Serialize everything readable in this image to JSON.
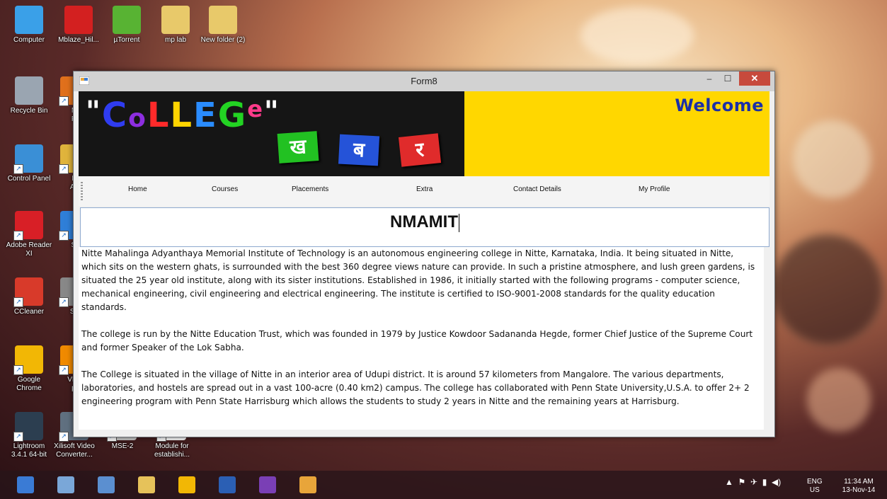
{
  "desktop": {
    "icons": [
      {
        "label": "Computer",
        "icon": "computer-icon",
        "color": "#3aa0e8"
      },
      {
        "label": "Mblaze_Hil...",
        "icon": "mblaze-icon",
        "color": "#d32020"
      },
      {
        "label": "µTorrent",
        "icon": "utorrent-icon",
        "color": "#58b333"
      },
      {
        "label": "mp lab",
        "icon": "folder-icon",
        "color": "#e8c96a"
      },
      {
        "label": "New folder (2)",
        "icon": "folder-icon",
        "color": "#e8c96a"
      },
      {
        "label": "Recycle Bin",
        "icon": "recycle-bin-icon",
        "color": "#9aa5b1"
      },
      {
        "label": "M\nFi",
        "icon": "firefox-icon",
        "color": "#e0701c"
      },
      {
        "label": "Control Panel",
        "icon": "control-panel-icon",
        "color": "#3a8fd6"
      },
      {
        "label": "N\nAn",
        "icon": "app-icon",
        "color": "#e0b43c"
      },
      {
        "label": "Adobe Reader XI",
        "icon": "adobe-reader-icon",
        "color": "#d81f26"
      },
      {
        "label": "Sl",
        "icon": "app-icon",
        "color": "#2f7fd8"
      },
      {
        "label": "CCleaner",
        "icon": "ccleaner-icon",
        "color": "#d83a2a"
      },
      {
        "label": "Sp",
        "icon": "app-icon",
        "color": "#888888"
      },
      {
        "label": "Google Chrome",
        "icon": "chrome-icon",
        "color": "#f2b705"
      },
      {
        "label": "VLC\npl",
        "icon": "vlc-icon",
        "color": "#f08a00"
      },
      {
        "label": "Lightroom 3.4.1 64-bit",
        "icon": "lightroom-icon",
        "color": "#2c3e50"
      },
      {
        "label": "Xilisoft Video Converter...",
        "icon": "xilisoft-icon",
        "color": "#607080"
      },
      {
        "label": "MSE-2",
        "icon": "document-icon",
        "color": "#cccccc"
      },
      {
        "label": "Module for establishi...",
        "icon": "document-icon",
        "color": "#ffffff"
      }
    ]
  },
  "window": {
    "title": "Form8",
    "minimize_label": "–",
    "maximize_label": "☐",
    "close_label": "✕",
    "banner": {
      "logo_text_quote_open": "\"",
      "logo_letters": [
        "C",
        "o",
        "L",
        "L",
        "E",
        "G",
        "e"
      ],
      "logo_quote_close": "\"",
      "tiles": [
        {
          "text": "ख",
          "color": "#22c122"
        },
        {
          "text": "ब",
          "color": "#2553d8"
        },
        {
          "text": "र",
          "color": "#e02b2b"
        }
      ],
      "welcome": "Welcome",
      "colors": {
        "left_bg": "#151515",
        "right_bg": "#ffd700",
        "welcome": "#1a2fa8"
      }
    },
    "menu": {
      "items": [
        "Home",
        "Courses",
        "Placements",
        "Extra",
        "Contact Details",
        "My Profile"
      ]
    },
    "title_box_value": "NMAMIT",
    "content": {
      "paragraphs": [
        "Nitte Mahalinga Adyanthaya Memorial Institute of Technology is an autonomous engineering college in Nitte, Karnataka, India. It being situated in Nitte, which sits on the western ghats, is surrounded with the best 360 degree views nature can provide. In such a pristine atmosphere, and lush green gardens, is situated the 25 year old institute, along with its sister institutions. Established in 1986, it initially started with the following programs - computer science, mechanical engineering, civil engineering and electrical engineering. The institute is certified to ISO-9001-2008 standards for the quality education standards.",
        "The college is run by the Nitte Education Trust, which was founded in 1979 by Justice Kowdoor Sadananda Hegde, former Chief Justice of the Supreme Court and former Speaker of the Lok Sabha.",
        "The College is situated in the village of Nitte in an interior area of Udupi district. It is around 57 kilometers from Mangalore. The various departments, laboratories, and hostels are spread out in a vast 100-acre (0.40 km2) campus. The college has collaborated with Penn State University,U.S.A. to offer 2+ 2 engineering program with Penn State Harrisburg which allows the students to study 2 years in Nitte and the remaining years at Harrisburg."
      ]
    }
  },
  "taskbar": {
    "apps": [
      {
        "icon": "search-icon",
        "color": "#3a7bd5"
      },
      {
        "icon": "photo-viewer-icon",
        "color": "#7aa7d8"
      },
      {
        "icon": "calculator-icon",
        "color": "#5b8fd0"
      },
      {
        "icon": "file-explorer-icon",
        "color": "#e6c25a"
      },
      {
        "icon": "chrome-icon",
        "color": "#f2b705"
      },
      {
        "icon": "word-icon",
        "color": "#2b5fb4"
      },
      {
        "icon": "visual-studio-icon",
        "color": "#7a3fb5"
      },
      {
        "icon": "winforms-app-icon",
        "color": "#e8a53a"
      }
    ],
    "tray": {
      "language_top": "ENG",
      "language_bottom": "US",
      "time": "11:34 AM",
      "date": "13-Nov-14"
    }
  }
}
